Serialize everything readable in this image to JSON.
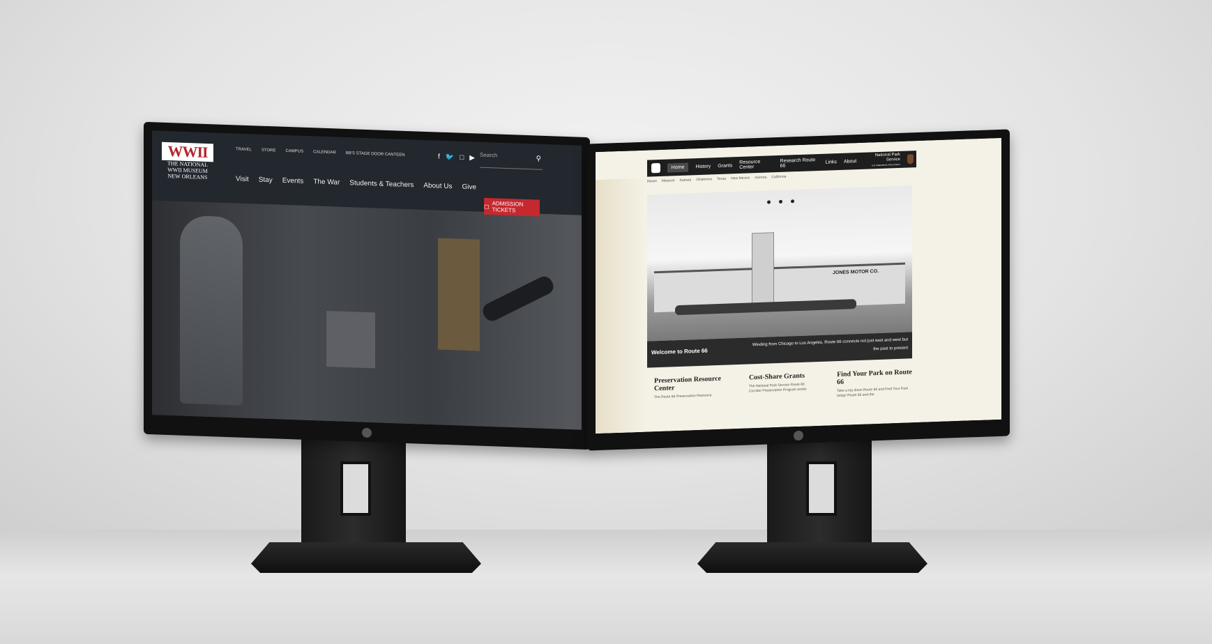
{
  "left_site": {
    "logo_mark": "WWII",
    "logo_line1": "THE NATIONAL",
    "logo_line2": "WWII MUSEUM",
    "logo_line3": "NEW ORLEANS",
    "utility_links": [
      "TRAVEL",
      "STORE",
      "CAMPUS",
      "CALENDAR",
      "BB'S STAGE DOOR CANTEEN"
    ],
    "nav_items": [
      "Visit",
      "Stay",
      "Events",
      "The War",
      "Students & Teachers",
      "About Us",
      "Give"
    ],
    "social_icons": [
      "facebook-icon",
      "twitter-icon",
      "instagram-icon",
      "youtube-icon"
    ],
    "search_placeholder": "Search",
    "ticket_button": "ADMISSION TICKETS"
  },
  "right_site": {
    "nav_items": [
      "Home",
      "History",
      "Grants",
      "Resource Center",
      "Research Route 66",
      "Links",
      "About"
    ],
    "agency_line1": "National Park Service",
    "agency_line2": "U.S. Department of the Interior",
    "sub_nav": [
      "Illinois",
      "Missouri",
      "Kansas",
      "Oklahoma",
      "Texas",
      "New Mexico",
      "Arizona",
      "California"
    ],
    "sign_text": "JONES MOTOR CO.",
    "welcome_title": "Welcome to Route 66",
    "welcome_text_1": "Winding from Chicago to Los Angeles, Route 66 connects not just east and west but",
    "welcome_text_2": "the past to present",
    "columns": [
      {
        "title_1": "Preservation Resource",
        "title_2": "Center",
        "text": "The Route 66 Preservation Resource"
      },
      {
        "title_1": "Cost-Share Grants",
        "title_2": "",
        "text": "The National Park Service Route 66 Corridor Preservation Program works"
      },
      {
        "title_1": "Find Your Park on Route 66",
        "title_2": "",
        "text": "Take a trip down Route 66 and Find Your Park today! Route 66 and the"
      }
    ]
  }
}
